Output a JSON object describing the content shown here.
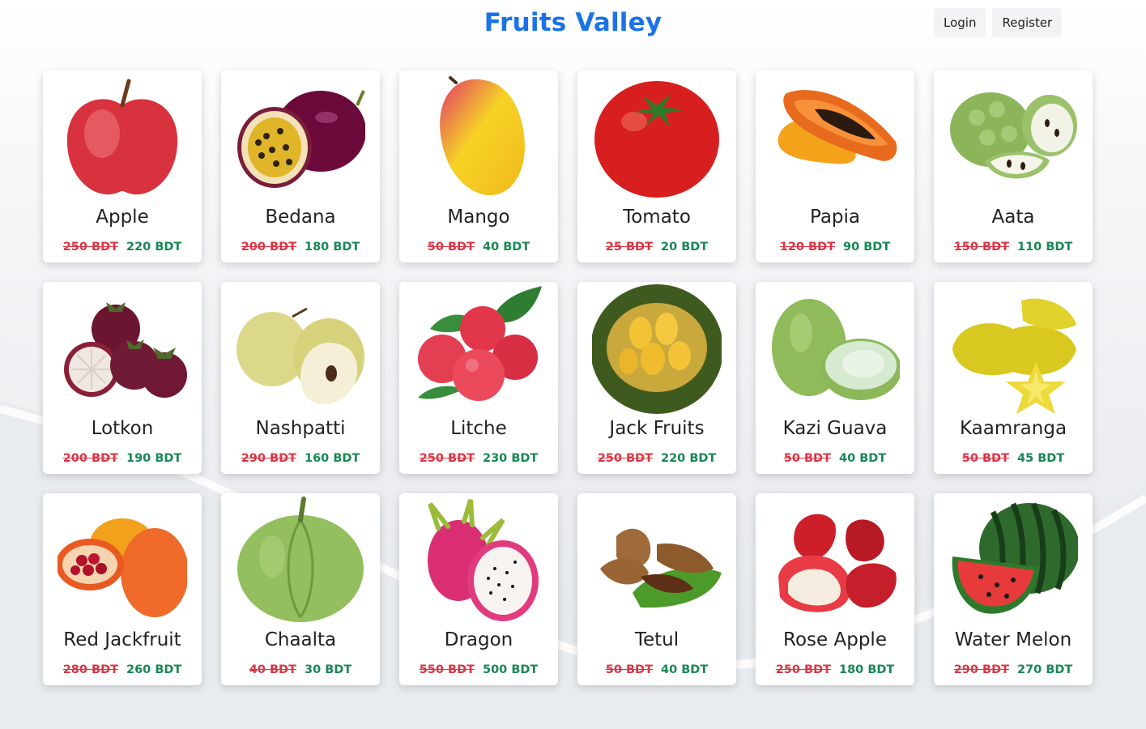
{
  "header": {
    "brand": "Fruits Valley"
  },
  "nav": {
    "login_label": "Login",
    "register_label": "Register"
  },
  "products": [
    {
      "name": "Apple",
      "old_price": "250 BDT",
      "new_price": "220 BDT",
      "icon": "apple-icon"
    },
    {
      "name": "Bedana",
      "old_price": "200 BDT",
      "new_price": "180 BDT",
      "icon": "passion-fruit-icon"
    },
    {
      "name": "Mango",
      "old_price": "50 BDT",
      "new_price": "40 BDT",
      "icon": "mango-icon"
    },
    {
      "name": "Tomato",
      "old_price": "25 BDT",
      "new_price": "20 BDT",
      "icon": "tomato-icon"
    },
    {
      "name": "Papia",
      "old_price": "120 BDT",
      "new_price": "90 BDT",
      "icon": "papaya-icon"
    },
    {
      "name": "Aata",
      "old_price": "150 BDT",
      "new_price": "110 BDT",
      "icon": "custard-apple-icon"
    },
    {
      "name": "Lotkon",
      "old_price": "200 BDT",
      "new_price": "190 BDT",
      "icon": "mangosteen-icon"
    },
    {
      "name": "Nashpatti",
      "old_price": "290 BDT",
      "new_price": "160 BDT",
      "icon": "pear-icon"
    },
    {
      "name": "Litche",
      "old_price": "250 BDT",
      "new_price": "230 BDT",
      "icon": "lychee-icon"
    },
    {
      "name": "Jack Fruits",
      "old_price": "250 BDT",
      "new_price": "220 BDT",
      "icon": "jackfruit-icon"
    },
    {
      "name": "Kazi Guava",
      "old_price": "50 BDT",
      "new_price": "40 BDT",
      "icon": "guava-icon"
    },
    {
      "name": "Kaamranga",
      "old_price": "50 BDT",
      "new_price": "45 BDT",
      "icon": "star-fruit-icon"
    },
    {
      "name": "Red Jackfruit",
      "old_price": "280 BDT",
      "new_price": "260 BDT",
      "icon": "gac-fruit-icon"
    },
    {
      "name": "Chaalta",
      "old_price": "40 BDT",
      "new_price": "30 BDT",
      "icon": "elephant-apple-icon"
    },
    {
      "name": "Dragon",
      "old_price": "550 BDT",
      "new_price": "500 BDT",
      "icon": "dragon-fruit-icon"
    },
    {
      "name": "Tetul",
      "old_price": "50 BDT",
      "new_price": "40 BDT",
      "icon": "tamarind-icon"
    },
    {
      "name": "Rose Apple",
      "old_price": "250 BDT",
      "new_price": "180 BDT",
      "icon": "rose-apple-icon"
    },
    {
      "name": "Water Melon",
      "old_price": "290 BDT",
      "new_price": "270 BDT",
      "icon": "watermelon-icon"
    }
  ]
}
